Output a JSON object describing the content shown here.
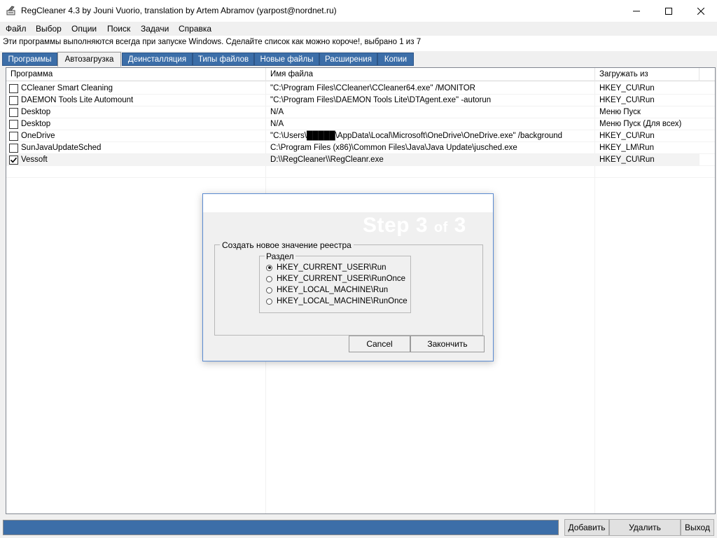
{
  "window": {
    "title": "RegCleaner 4.3 by Jouni Vuorio, translation by Artem Abramov (yarpost@nordnet.ru)"
  },
  "caption": {
    "minimize": "—",
    "maximize": "☐",
    "close": "✕"
  },
  "menu": [
    "Файл",
    "Выбор",
    "Опции",
    "Поиск",
    "Задачи",
    "Справка"
  ],
  "info_text": "Эти программы выполняются всегда при запуске Windows. Сделайте список как можно короче!, выбрано 1 из 7",
  "tabs": [
    "Программы",
    "Автозагрузка",
    "Деинсталляция",
    "Типы файлов",
    "Новые файлы",
    "Расширения",
    "Копии"
  ],
  "active_tab": "Автозагрузка",
  "list": {
    "columns": [
      "Программа",
      "Имя файла",
      "Загружать из"
    ],
    "rows": [
      {
        "checked": false,
        "program": "CCleaner Smart Cleaning",
        "file": "\"C:\\Program Files\\CCleaner\\CCleaner64.exe\" /MONITOR",
        "source": "HKEY_CU\\Run"
      },
      {
        "checked": false,
        "program": "DAEMON Tools Lite Automount",
        "file": "\"C:\\Program Files\\DAEMON Tools Lite\\DTAgent.exe\" -autorun",
        "source": "HKEY_CU\\Run"
      },
      {
        "checked": false,
        "program": "Desktop",
        "file": "N/A",
        "source": "Меню Пуск"
      },
      {
        "checked": false,
        "program": "Desktop",
        "file": "N/A",
        "source": "Меню Пуск (Для всех)"
      },
      {
        "checked": false,
        "program": "OneDrive",
        "file": "\"C:\\Users\\█████\\AppData\\Local\\Microsoft\\OneDrive\\OneDrive.exe\" /background",
        "source": "HKEY_CU\\Run"
      },
      {
        "checked": false,
        "program": "SunJavaUpdateSched",
        "file": "C:\\Program Files (x86)\\Common Files\\Java\\Java Update\\jusched.exe",
        "source": "HKEY_LM\\Run"
      },
      {
        "checked": true,
        "program": "Vessoft",
        "file": "D:\\\\RegCleaner\\\\RegCleanr.exe",
        "source": "HKEY_CU\\Run"
      }
    ]
  },
  "bottom": {
    "add": "Добавить",
    "delete": "Удалить",
    "exit": "Выход"
  },
  "dialog": {
    "step_word": "Step",
    "step_current": "3",
    "step_of": "of",
    "step_total": "3",
    "group_label": "Создать новое значение реестра",
    "section_label": "Раздел",
    "options": [
      "HKEY_CURRENT_USER\\Run",
      "HKEY_CURRENT_USER\\RunOnce",
      "HKEY_LOCAL_MACHINE\\Run",
      "HKEY_LOCAL_MACHINE\\RunOnce"
    ],
    "selected_option": "HKEY_CURRENT_USER\\Run",
    "cancel": "Cancel",
    "finish": "Закончить"
  },
  "colors": {
    "accent": "#3c6ea8",
    "dialog_border": "#5a8ad0"
  }
}
